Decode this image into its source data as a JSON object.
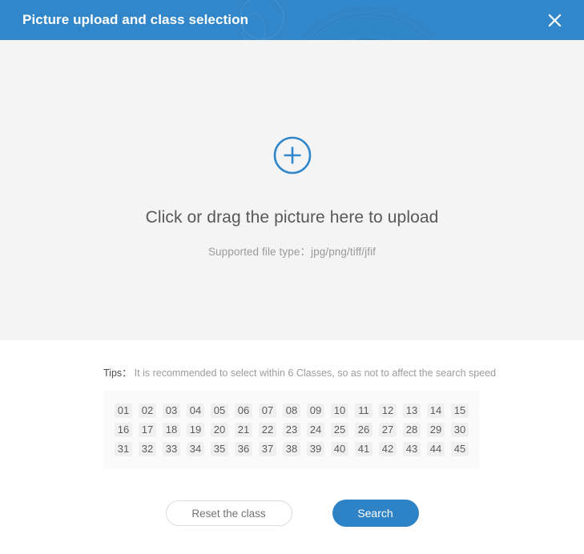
{
  "header": {
    "title": "Picture upload and class selection",
    "close_label": "×",
    "bg_color": "#3287ca"
  },
  "upload": {
    "icon": "plus-circle-icon",
    "main_text": "Click or drag the picture here to upload",
    "sub_text": "Supported file type：jpg/png/tiff/jfif",
    "bg_color": "#f4f4f4",
    "accent_color": "#3287ca"
  },
  "tips": {
    "label": "Tips：",
    "text": "It is recommended to select within 6 Classes, so as not to affect the search speed"
  },
  "classes": {
    "rows": [
      [
        "01",
        "02",
        "03",
        "04",
        "05",
        "06",
        "07",
        "08",
        "09",
        "10",
        "11",
        "12",
        "13",
        "14",
        "15"
      ],
      [
        "16",
        "17",
        "18",
        "19",
        "20",
        "21",
        "22",
        "23",
        "24",
        "25",
        "26",
        "27",
        "28",
        "29",
        "30"
      ],
      [
        "31",
        "32",
        "33",
        "34",
        "35",
        "36",
        "37",
        "38",
        "39",
        "40",
        "41",
        "42",
        "43",
        "44",
        "45"
      ]
    ]
  },
  "footer": {
    "reset_label": "Reset the class",
    "search_label": "Search",
    "search_color": "#2e83c6"
  }
}
